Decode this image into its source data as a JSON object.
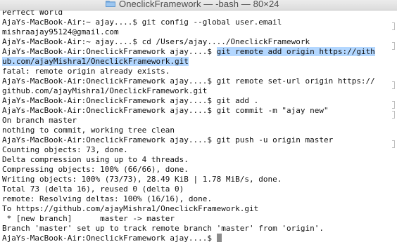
{
  "window": {
    "title": "OneclickFramework — -bash — 80×24",
    "folder_icon": "folder-icon",
    "colors": {
      "background": "#ffffff",
      "text": "#111111",
      "selection": "#b3d7ff",
      "cursor": "#8c8c8c"
    }
  },
  "terminal": {
    "lines": [
      "Perfect World",
      "AjaYs-MacBook-Air:~ ajay....$ git config --global user.email",
      "mishraajay95124@gmail.com",
      "AjaYs-MacBook-Air:~ ajay....$ cd /Users/ajay..../OneclickFramework",
      "AjaYs-MacBook-Air:OneclickFramework ajay....$ ",
      "ub.com/ajayMishra1/OneclickFramework.git",
      "fatal: remote origin already exists.",
      "AjaYs-MacBook-Air:OneclickFramework ajay....$ git remote set-url origin https://",
      "github.com/ajayMishra1/OneclickFramework.git",
      "AjaYs-MacBook-Air:OneclickFramework ajay....$ git add .",
      "AjaYs-MacBook-Air:OneclickFramework ajay....$ git commit -m \"ajay new\"",
      "On branch master",
      "nothing to commit, working tree clean",
      "AjaYs-MacBook-Air:OneclickFramework ajay....$ git push -u origin master",
      "Counting objects: 73, done.",
      "Delta compression using up to 4 threads.",
      "Compressing objects: 100% (66/66), done.",
      "Writing objects: 100% (73/73), 28.49 KiB | 1.78 MiB/s, done.",
      "Total 73 (delta 16), reused 0 (delta 0)",
      "remote: Resolving deltas: 100% (16/16), done.",
      "To https://github.com/ajayMishra1/OneclickFramework.git",
      " * [new branch]      master -> master",
      "Branch 'master' set up to track remote branch 'master' from 'origin'.",
      "AjaYs-MacBook-Air:OneclickFramework ajay....$ "
    ],
    "selected_command": "git remote add origin https://gith",
    "selected_continuation": "ub.com/ajayMishra1/OneclickFramework.git"
  }
}
